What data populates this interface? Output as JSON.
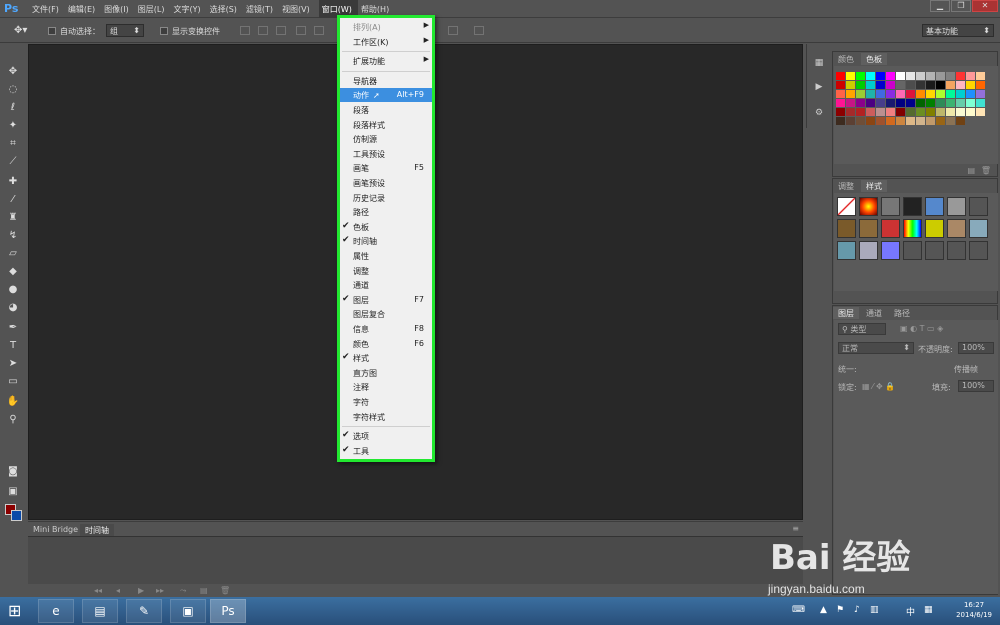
{
  "app": {
    "logo": "Ps"
  },
  "menubar": {
    "items": [
      "文件(F)",
      "编辑(E)",
      "图像(I)",
      "图层(L)",
      "文字(Y)",
      "选择(S)",
      "滤镜(T)",
      "视图(V)",
      "窗口(W)",
      "帮助(H)"
    ],
    "active_index": 8
  },
  "optionsbar": {
    "auto_select_label": "自动选择：",
    "auto_select_value": "组",
    "show_transform_label": "显示变换控件",
    "workspace_value": "基本功能"
  },
  "window_menu": {
    "items": [
      {
        "label": "排列(A)",
        "submenu": true,
        "disabled": true
      },
      {
        "label": "工作区(K)",
        "submenu": true
      },
      {
        "sep": true
      },
      {
        "label": "扩展功能",
        "submenu": true
      },
      {
        "sep": true
      },
      {
        "label": "导航器"
      },
      {
        "label": "动作",
        "shortcut": "Alt+F9",
        "highlight": true
      },
      {
        "label": "段落"
      },
      {
        "label": "段落样式"
      },
      {
        "label": "仿制源"
      },
      {
        "label": "工具预设"
      },
      {
        "label": "画笔",
        "shortcut": "F5"
      },
      {
        "label": "画笔预设"
      },
      {
        "label": "历史记录"
      },
      {
        "label": "路径"
      },
      {
        "label": "色板",
        "checked": true
      },
      {
        "label": "时间轴",
        "checked": true
      },
      {
        "label": "属性"
      },
      {
        "label": "调整"
      },
      {
        "label": "通道"
      },
      {
        "label": "图层",
        "shortcut": "F7",
        "checked": true
      },
      {
        "label": "图层复合"
      },
      {
        "label": "信息",
        "shortcut": "F8"
      },
      {
        "label": "颜色",
        "shortcut": "F6"
      },
      {
        "label": "样式",
        "checked": true
      },
      {
        "label": "直方图"
      },
      {
        "label": "注释"
      },
      {
        "label": "字符"
      },
      {
        "label": "字符样式"
      },
      {
        "sep": true
      },
      {
        "label": "选项",
        "checked": true
      },
      {
        "label": "工具",
        "checked": true
      }
    ]
  },
  "bottom_panel": {
    "tabs": [
      "Mini Bridge",
      "时间轴"
    ],
    "active_index": 1
  },
  "color_panel": {
    "tabs": [
      "颜色",
      "色板"
    ],
    "active_index": 1
  },
  "styles_panel": {
    "tabs": [
      "调整",
      "样式"
    ],
    "active_index": 1
  },
  "layers_panel": {
    "tabs": [
      "图层",
      "通道",
      "路径"
    ],
    "active_index": 0,
    "filter_value": "类型",
    "blend_mode": "正常",
    "opacity_label": "不透明度:",
    "opacity_value": "100%",
    "lock_label": "锁定:",
    "fill_label": "填充:",
    "fill_value": "100%",
    "unify_label": "统一:",
    "propagate_label": "传播帧"
  },
  "watermark": {
    "brand": "Bai 经验",
    "url": "jingyan.baidu.com"
  },
  "taskbar": {
    "time": "16:27",
    "date": "2014/6/19",
    "ime": "中"
  },
  "colors": {
    "highlight": "#3c8fe0",
    "menu_outline": "#22e830",
    "foreground": "#8b0000",
    "background": "#0a4aa8"
  }
}
